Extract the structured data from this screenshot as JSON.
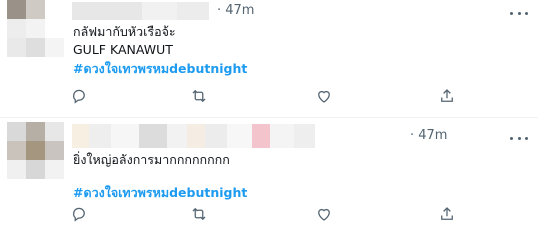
{
  "tweets": [
    {
      "time": "· 47m",
      "lines": [
        "กลัฟมากับหัวเรือจ้ะ",
        "GULF KANAWUT"
      ],
      "hashtag": "#ดวงใจเทวพรหมdebutnight",
      "avatar_colors": [
        "#9a9288",
        "#cfcac4",
        "#ffffff",
        "#ededed",
        "#f3f3f3",
        "#ffffff",
        "#e9e9e9",
        "#dedede",
        "#f4f4f4"
      ],
      "name_blur_colors": [
        "#e7e7e7",
        "#f1f1f1",
        "#ececec"
      ],
      "icons": [
        "reply-icon",
        "retweet-icon",
        "like-icon",
        "share-icon"
      ]
    },
    {
      "time": "· 47m",
      "lines": [
        "ยิ่งใหญ่อลังการมากกกกกกกก"
      ],
      "hashtag": "#ดวงใจเทวพรหมdebutnight",
      "avatar_colors": [
        "#d9d9d9",
        "#b6afa6",
        "#e7e7e7",
        "#c9c3bb",
        "#a5977f",
        "#c9c4bf",
        "#f0f0f0",
        "#d7d7d7",
        "#f2f2f2"
      ],
      "name_blur_colors": [
        "#f7efe2",
        "#eeeeee",
        "#f6f6f6",
        "#dcdcdc",
        "#f2f2f2",
        "#f5ece4",
        "#ececec",
        "#f7f7f7",
        "#f3c4cb",
        "#f4f4f4",
        "#eeeeee"
      ],
      "icons": [
        "reply-icon",
        "retweet-icon",
        "like-icon",
        "share-icon"
      ]
    }
  ]
}
